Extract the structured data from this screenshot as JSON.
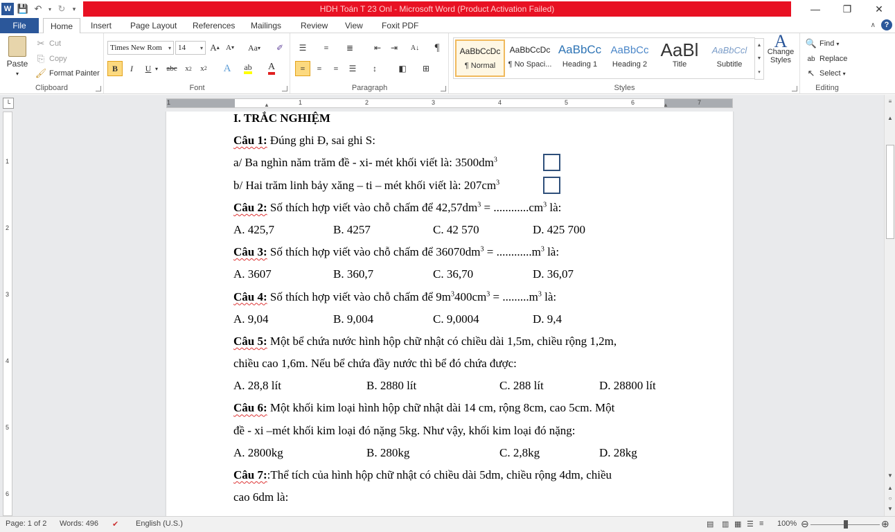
{
  "window": {
    "title": "HDH Toán T 23 Onl  -  Microsoft Word (Product Activation Failed)",
    "app_icon": "W"
  },
  "tabs": [
    "File",
    "Home",
    "Insert",
    "Page Layout",
    "References",
    "Mailings",
    "Review",
    "View",
    "Foxit PDF"
  ],
  "active_tab": "Home",
  "ribbon": {
    "clipboard": {
      "paste": "Paste",
      "cut": "Cut",
      "copy": "Copy",
      "format_painter": "Format Painter",
      "label": "Clipboard"
    },
    "font": {
      "family": "Times New Rom",
      "size": "14",
      "label": "Font"
    },
    "paragraph": {
      "label": "Paragraph"
    },
    "styles": {
      "label": "Styles",
      "items": [
        {
          "sample": "AaBbCcDc",
          "name": "¶ Normal"
        },
        {
          "sample": "AaBbCcDc",
          "name": "¶ No Spaci..."
        },
        {
          "sample": "AaBbCc",
          "name": "Heading 1"
        },
        {
          "sample": "AaBbCc",
          "name": "Heading 2"
        },
        {
          "sample": "AaBl",
          "name": "Title"
        },
        {
          "sample": "AaBbCcl",
          "name": "Subtitle"
        }
      ],
      "change_styles": "Change Styles"
    },
    "editing": {
      "find": "Find",
      "replace": "Replace",
      "select": "Select",
      "label": "Editing"
    }
  },
  "ruler": {
    "numbers": [
      "1",
      "1",
      "2",
      "3",
      "4",
      "5",
      "6",
      "7"
    ]
  },
  "document": {
    "heading": "I. TRẮC NGHIỆM",
    "q1_label": "Câu 1:",
    "q1_text": " Đúng ghi Đ, sai ghi S:",
    "q1_a": "a/ Ba nghìn năm trăm đề - xi- mét khối viết là: 3500dm",
    "q1_b": "b/ Hai trăm linh bảy xăng – ti – mét khối viết là: 207cm",
    "sup3": "3",
    "q2_label": "Câu 2:",
    "q2_text_pre": " Số thích hợp viết vào chỗ chấm để 42,57dm",
    "q2_text_mid": " = ............cm",
    "q2_text_post": " là:",
    "q2_choices": [
      "A. 425,7",
      "B. 4257",
      "C. 42 570",
      "D. 425 700"
    ],
    "q3_label": "Câu 3:",
    "q3_text_pre": " Số thích hợp viết vào chỗ chấm để 36070dm",
    "q3_text_mid": " = ............m",
    "q3_text_post": " là:",
    "q3_choices": [
      "A. 3607",
      "B. 360,7",
      "C. 36,70",
      "D. 36,07"
    ],
    "q4_label": "Câu 4:",
    "q4_text_pre": " Số thích hợp viết vào chỗ chấm để 9m",
    "q4_text_mid": "400cm",
    "q4_text_mid2": " = .........m",
    "q4_text_post": " là:",
    "q4_choices": [
      "A. 9,04",
      "B. 9,004",
      "C. 9,0004",
      "D. 9,4"
    ],
    "q5_label": "Câu 5:",
    "q5_text": " Một bể chứa nước hình hộp chữ nhật có chiều dài 1,5m, chiều rộng 1,2m,",
    "q5_text2": "chiều cao 1,6m. Nếu bể chứa đầy nước thì bể đó chứa được:",
    "q5_choices": [
      "A. 28,8 lít",
      "B. 2880 lít",
      "C. 288 lít",
      "D. 28800 lít"
    ],
    "q6_label": "Câu 6:",
    "q6_text": " Một khối kim loại hình hộp chữ nhật dài 14 cm, rộng 8cm, cao 5cm. Một",
    "q6_text2": "đề - xi –mét khối kim loại đó nặng 5kg. Như vậy, khối kim loại đó nặng:",
    "q6_choices": [
      "A. 2800kg",
      "B. 280kg",
      "C. 2,8kg",
      "D. 28kg"
    ],
    "q7_label": "Câu 7:",
    "q7_text": ":Thể tích của hình hộp chữ nhật có chiều dài 5dm, chiều rộng 4dm, chiều",
    "q7_text2": "cao 6dm là:"
  },
  "statusbar": {
    "page": "Page: 1 of 2",
    "words": "Words: 496",
    "language": "English (U.S.)",
    "zoom": "100%"
  }
}
